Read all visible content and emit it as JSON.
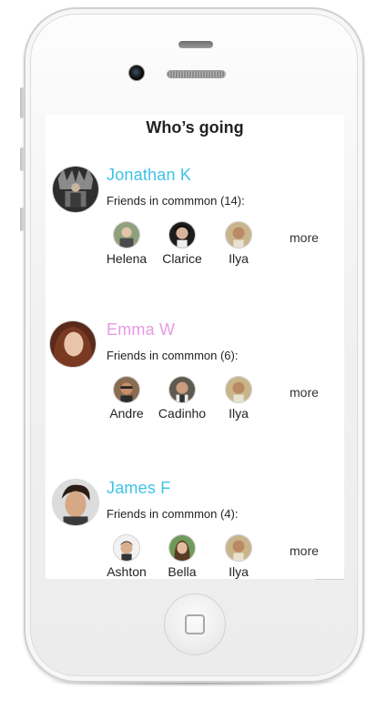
{
  "page": {
    "title": "Who’s going"
  },
  "colors": {
    "accent_blue": "#3fc2e6",
    "accent_pink": "#e79ae3"
  },
  "attendees": [
    {
      "name": "Jonathan K",
      "name_color": "#3fc2e6",
      "friends_label": "Friends in commmon (14):",
      "friends": [
        "Helena",
        "Clarice",
        "Ilya"
      ],
      "more_label": "more"
    },
    {
      "name": "Emma W",
      "name_color": "#e79ae3",
      "friends_label": "Friends in commmon (6):",
      "friends": [
        "Andre",
        "Cadinho",
        "Ilya"
      ],
      "more_label": "more"
    },
    {
      "name": "James F",
      "name_color": "#3fc2e6",
      "friends_label": "Friends in commmon (4):",
      "friends": [
        "Ashton",
        "Bella",
        "Ilya"
      ],
      "more_label": "more"
    }
  ]
}
